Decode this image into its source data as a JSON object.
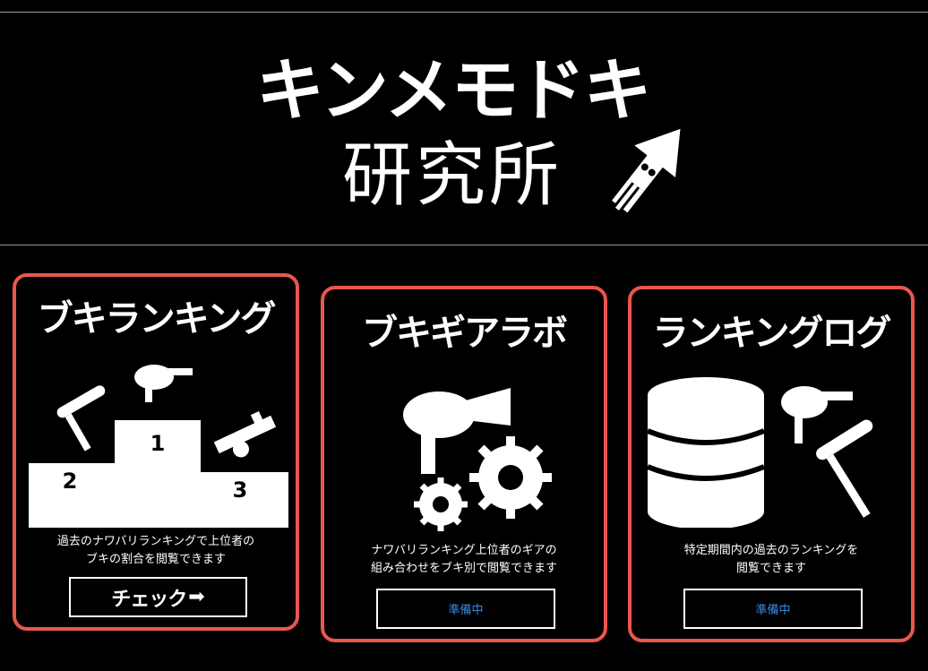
{
  "header": {
    "title_line1": "キンメモドキ",
    "title_line2": "研究所",
    "logo_icon": "squid-arrow-icon"
  },
  "cards": [
    {
      "title": "ブキランキング",
      "desc_line1": "過去のナワバリランキングで上位者の",
      "desc_line2": "ブキの割合を閲覧できます",
      "button_label": "チェック",
      "button_icon": "arrow-right-icon",
      "podium": {
        "first": "1",
        "second": "2",
        "third": "3"
      }
    },
    {
      "title": "ブキギアラボ",
      "desc_line1": "ナワバリランキング上位者のギアの",
      "desc_line2": "組み合わせをブキ別で閲覧できます",
      "button_label": "準備中"
    },
    {
      "title": "ランキングログ",
      "desc_line1": "特定期間内の過去のランキングを",
      "desc_line2": "閲覧できます",
      "button_label": "準備中"
    }
  ],
  "colors": {
    "background": "#000000",
    "card_border": "#e9564e",
    "pending_text": "#3b8be0",
    "text": "#ffffff"
  }
}
